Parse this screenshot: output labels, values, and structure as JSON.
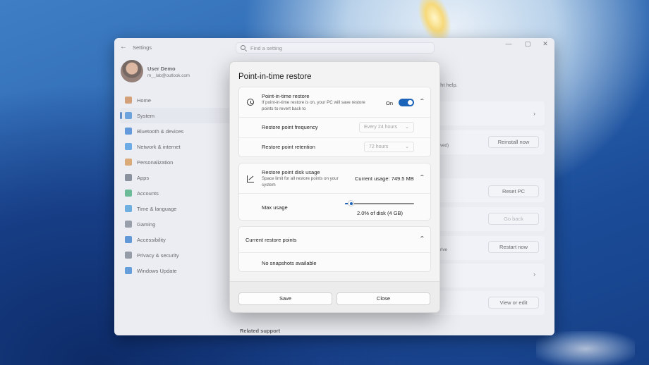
{
  "settings": {
    "title": "Settings",
    "search_placeholder": "Find a setting",
    "window_controls": [
      "—",
      "▢",
      "✕"
    ],
    "user": {
      "name": "User Demo",
      "email": "m__lab@outlook.com"
    },
    "nav": [
      {
        "label": "Home",
        "icon": "home-icon",
        "color": "#c97a3a"
      },
      {
        "label": "System",
        "icon": "system-icon",
        "color": "#2d7fd3",
        "active": true
      },
      {
        "label": "Bluetooth & devices",
        "icon": "bluetooth-icon",
        "color": "#1f6fd1"
      },
      {
        "label": "Network & internet",
        "icon": "network-icon",
        "color": "#2b8be0"
      },
      {
        "label": "Personalization",
        "icon": "personalization-icon",
        "color": "#d48a3a"
      },
      {
        "label": "Apps",
        "icon": "apps-icon",
        "color": "#5b6574"
      },
      {
        "label": "Accounts",
        "icon": "accounts-icon",
        "color": "#2aa36b"
      },
      {
        "label": "Time & language",
        "icon": "time-language-icon",
        "color": "#2f8fd8"
      },
      {
        "label": "Gaming",
        "icon": "gaming-icon",
        "color": "#6f7885"
      },
      {
        "label": "Accessibility",
        "icon": "accessibility-icon",
        "color": "#1c6ec9"
      },
      {
        "label": "Privacy & security",
        "icon": "privacy-shield-icon",
        "color": "#6b7380"
      },
      {
        "label": "Windows Update",
        "icon": "windows-update-icon",
        "color": "#1f77d0"
      }
    ],
    "background": {
      "help_fragment": "ght help.",
      "saved_fragment": "ved)",
      "drive_fragment": "rive",
      "reinstall_label": "Reinstall now",
      "reset_label": "Reset PC",
      "goback_label": "Go back",
      "restart_label": "Restart now",
      "view_edit_label": "View or edit",
      "related_support": "Related support"
    }
  },
  "dialog": {
    "title": "Point-in-time restore",
    "pitr": {
      "heading": "Point-in-time restore",
      "description": "If point-in-time restore is on, your PC will save restore points to revert back to",
      "state_label": "On",
      "toggle_on": true,
      "frequency_label": "Restore point frequency",
      "frequency_value": "Every 24 hours",
      "retention_label": "Restore point retention",
      "retention_value": "72 hours"
    },
    "disk": {
      "heading": "Restore point disk usage",
      "description": "Space limit for all restore points on your system",
      "current_usage": "Current usage: 749.5 MB",
      "max_usage_label": "Max usage",
      "max_usage_value": "2.0% of disk (4 GB)",
      "slider_fraction": 0.02
    },
    "points": {
      "heading": "Current restore points",
      "empty_text": "No snapshots available"
    },
    "save_label": "Save",
    "close_label": "Close",
    "icons": {
      "history": "history-icon",
      "chart": "chart-icon"
    },
    "accent": "#1a63b8"
  }
}
